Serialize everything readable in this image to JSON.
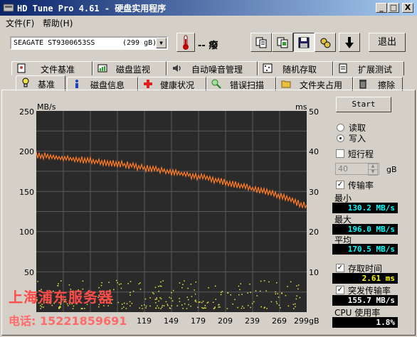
{
  "window": {
    "title": "HD Tune Pro 4.61 - 硬盘实用程序",
    "controls": [
      "_",
      "□",
      "X"
    ]
  },
  "menu": [
    "文件(F)",
    "帮助(H)"
  ],
  "toolbar": {
    "drive_name": "SEAGATE ST9300653SS",
    "drive_size": "(299 gB)",
    "temperature": "-- 癈",
    "exit_label": "退出",
    "icons": [
      "copy-info-icon",
      "copy-screenshot-icon",
      "save-icon",
      "options-icon",
      "down-arrow-icon"
    ]
  },
  "tabs_row1": [
    {
      "label": "文件基准",
      "icon": "file-benchmark-icon"
    },
    {
      "label": "磁盘监视",
      "icon": "disk-monitor-icon"
    },
    {
      "label": "自动噪音管理",
      "icon": "speaker-icon"
    },
    {
      "label": "随机存取",
      "icon": "random-access-icon"
    },
    {
      "label": "扩展测试",
      "icon": "extra-tests-icon"
    }
  ],
  "tabs_row2": [
    {
      "label": "基准",
      "icon": "benchmark-icon",
      "active": true
    },
    {
      "label": "磁盘信息",
      "icon": "info-icon"
    },
    {
      "label": "健康状况",
      "icon": "health-icon"
    },
    {
      "label": "错误扫描",
      "icon": "error-scan-icon"
    },
    {
      "label": "文件夹占用",
      "icon": "folder-usage-icon"
    },
    {
      "label": "擦除",
      "icon": "erase-icon"
    }
  ],
  "side": {
    "start_label": "Start",
    "read_label": "读取",
    "write_label": "写入",
    "mode_selected": "write",
    "short_stroke_label": "短行程",
    "short_stroke_checked": false,
    "short_stroke_value": "40",
    "short_stroke_unit": "gB",
    "transfer_rate_label": "传输率",
    "transfer_rate_checked": true,
    "min_label": "最小",
    "min_value": "130.2 MB/s",
    "max_label": "最大",
    "max_value": "196.0 MB/s",
    "avg_label": "平均",
    "avg_value": "170.5 MB/s",
    "access_time_label": "存取时间",
    "access_time_checked": true,
    "access_time_value": "2.61 ms",
    "burst_label": "突发传输率",
    "burst_checked": true,
    "burst_value": "155.7 MB/s",
    "cpu_label": "CPU 使用率",
    "cpu_value": "1.8%"
  },
  "watermark": {
    "line1": "上海浦东服务器",
    "line2": "电话: 15221859691"
  },
  "chart_data": {
    "type": "line",
    "xlabel": "gB",
    "ylabel": "MB/s",
    "y2label": "ms",
    "xlim": [
      0,
      299
    ],
    "ylim": [
      0,
      250
    ],
    "y2lim": [
      0,
      50
    ],
    "x_ticks": [
      "119",
      "149",
      "179",
      "209",
      "239",
      "269",
      "299gB"
    ],
    "y_ticks": [
      "250",
      "200",
      "150",
      "100",
      "50"
    ],
    "y2_ticks": [
      "50",
      "40",
      "30",
      "20",
      "10"
    ],
    "grid": true,
    "transfer_rate": {
      "x": [
        0,
        15,
        30,
        45,
        60,
        75,
        90,
        105,
        120,
        135,
        150,
        165,
        180,
        195,
        210,
        225,
        240,
        255,
        270,
        285,
        299
      ],
      "y": [
        195,
        193,
        191,
        190,
        188,
        186,
        184,
        182,
        179,
        177,
        174,
        171,
        168,
        165,
        161,
        158,
        153,
        149,
        144,
        138,
        131
      ],
      "color": "#ff7a2a"
    },
    "access_time": {
      "color": "#e8e84a",
      "y_range_ms": [
        1,
        8
      ]
    }
  }
}
